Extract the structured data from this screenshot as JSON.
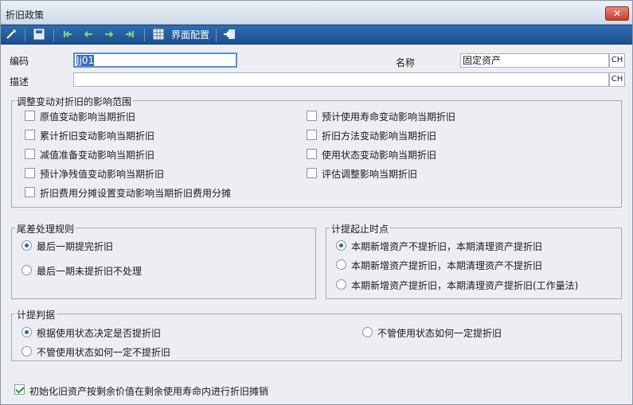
{
  "window": {
    "title": "折旧政策",
    "close_label": "✕"
  },
  "toolbar": {
    "config_label": "界面配置"
  },
  "form": {
    "code_label": "编码",
    "code_value": "Jj01",
    "name_label": "名称",
    "name_value": "固定资产",
    "desc_label": "描述",
    "desc_value": "",
    "ch_label": "CH"
  },
  "scope": {
    "title": "调整变动对折旧的影响范围",
    "left": [
      "原值变动影响当期折旧",
      "累计折旧变动影响当期折旧",
      "减值准备变动影响当期折旧",
      "预计净残值变动影响当期折旧",
      "折旧费用分摊设置变动影响当期折旧费用分摊"
    ],
    "right": [
      "预计使用寿命变动影响当期折旧",
      "折旧方法变动影响当期折旧",
      "使用状态变动影响当期折旧",
      "评估调整影响当期折旧"
    ]
  },
  "residual": {
    "title": "尾差处理规则",
    "options": [
      "最后一期提完折旧",
      "最后一期未提折旧不处理"
    ],
    "selected": 0
  },
  "timing": {
    "title": "计提起止时点",
    "options": [
      "本期新增资产不提折旧，本期清理资产提折旧",
      "本期新增资产提折旧，本期清理资产不提折旧",
      "本期新增资产提折旧，本期清理资产提折旧(工作量法)"
    ],
    "selected": 0
  },
  "judge": {
    "title": "计提判据",
    "options": [
      "根据使用状态决定是否提折旧",
      "不管使用状态如何一定不提折旧",
      "不管使用状态如何一定提折旧"
    ],
    "selected": 0
  },
  "init": {
    "label": "初始化旧资产按剩余价值在剩余使用寿命内进行折旧摊销",
    "checked": true
  },
  "colors": {
    "toolbar": "#1d4f8c",
    "close": "#c6402c"
  }
}
